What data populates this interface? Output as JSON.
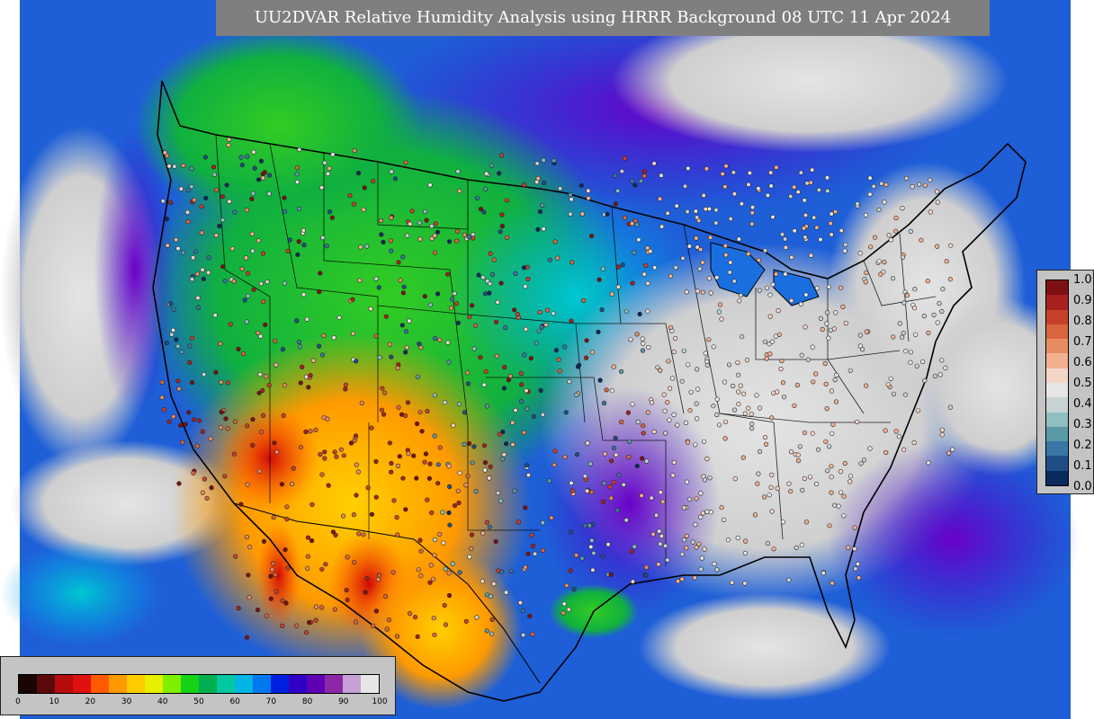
{
  "title": "UU2DVAR Relative Humidity Analysis using HRRR Background 08 UTC 11 Apr 2024",
  "colorbar_observations": {
    "ticks": [
      "0.0",
      "0.1",
      "0.2",
      "0.3",
      "0.4",
      "0.5",
      "0.6",
      "0.7",
      "0.8",
      "0.9",
      "1.0"
    ],
    "colors": [
      "#0a2a5c",
      "#1f4e86",
      "#3a76a6",
      "#5a9aa6",
      "#8fbfbf",
      "#c8d2d2",
      "#e6e6e6",
      "#f4d6c8",
      "#f3b08f",
      "#e78c62",
      "#d9653e",
      "#c7412a",
      "#a8211e",
      "#7d1012"
    ]
  },
  "colorbar_analysis": {
    "ticks": [
      "0",
      "10",
      "20",
      "30",
      "40",
      "50",
      "60",
      "70",
      "80",
      "90",
      "100"
    ],
    "colors": [
      "#1a0505",
      "#5a0a0a",
      "#b50d0d",
      "#e01010",
      "#ff5a00",
      "#ff9900",
      "#ffcc00",
      "#e6f000",
      "#7cf000",
      "#15d215",
      "#00b050",
      "#00c8a0",
      "#00b4e6",
      "#0078f0",
      "#0020e0",
      "#3000c8",
      "#6000b4",
      "#8c28a8",
      "#c8a0d8",
      "#e6e6e6"
    ]
  },
  "map": {
    "regions": [
      {
        "name": "ocean-pacific",
        "color": "#1e5fd7"
      },
      {
        "name": "dry-southwest",
        "color": "#ff9a00"
      },
      {
        "name": "very-dry-southwest",
        "color": "#e01010"
      },
      {
        "name": "plains-green",
        "color": "#10c040"
      },
      {
        "name": "moist-east",
        "color": "#d8d8d8"
      },
      {
        "name": "humid-north",
        "color": "#7a10c8"
      },
      {
        "name": "gulf-blue",
        "color": "#2060ff"
      }
    ]
  }
}
